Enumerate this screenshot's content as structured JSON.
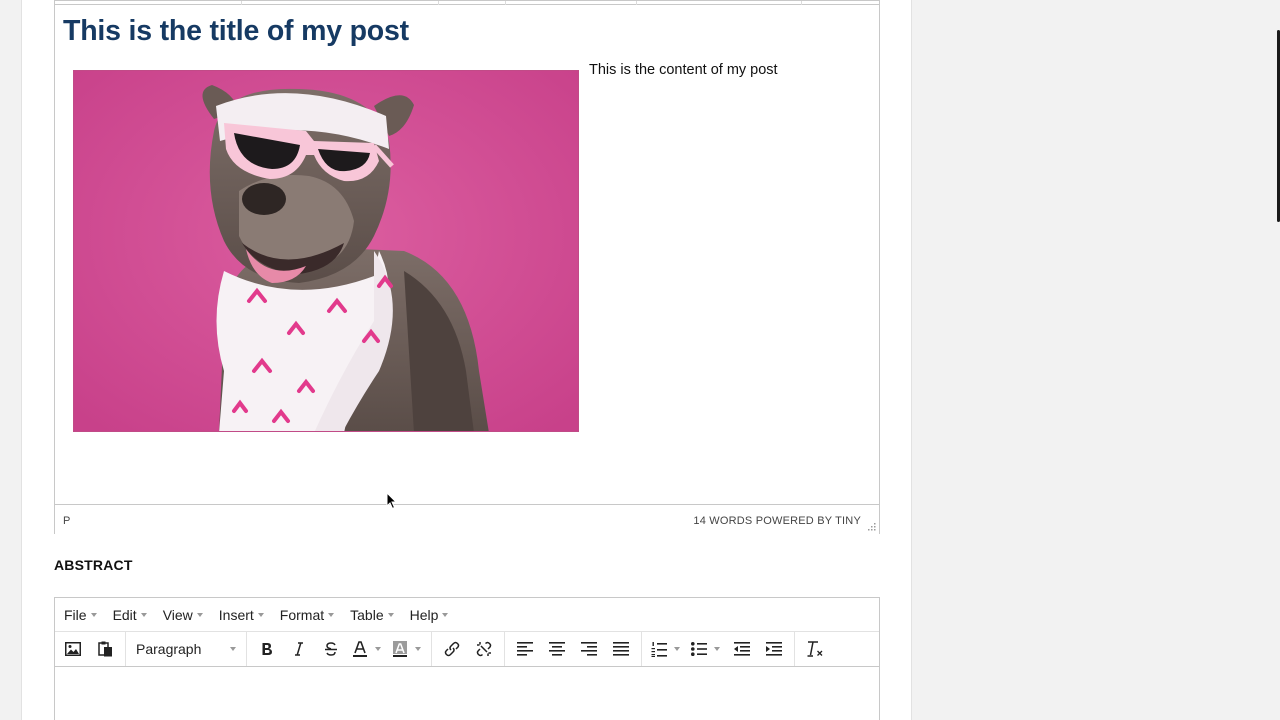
{
  "post": {
    "title": "This is the title of my post",
    "content": "This is the content of my post",
    "image_alt": "Dog wearing pink sunglasses and a pink ribbon scarf"
  },
  "status_bar": {
    "path": "P",
    "word_count": "14 WORDS",
    "powered": "POWERED BY TINY"
  },
  "abstract": {
    "label": "ABSTRACT",
    "menu": [
      "File",
      "Edit",
      "View",
      "Insert",
      "Format",
      "Table",
      "Help"
    ],
    "format_select": "Paragraph"
  },
  "icons": {
    "toolbar": [
      "image-icon",
      "paste-icon",
      "bold-icon",
      "italic-icon",
      "strikethrough-icon",
      "text-color-icon",
      "highlight-icon",
      "link-icon",
      "unlink-icon",
      "align-left-icon",
      "align-center-icon",
      "align-right-icon",
      "justify-icon",
      "numbered-list-icon",
      "bulleted-list-icon",
      "outdent-icon",
      "indent-icon",
      "clear-formatting-icon"
    ]
  },
  "colors": {
    "title": "#163a63",
    "background": "#f2f2f2",
    "photo_background": "#d34c91"
  }
}
